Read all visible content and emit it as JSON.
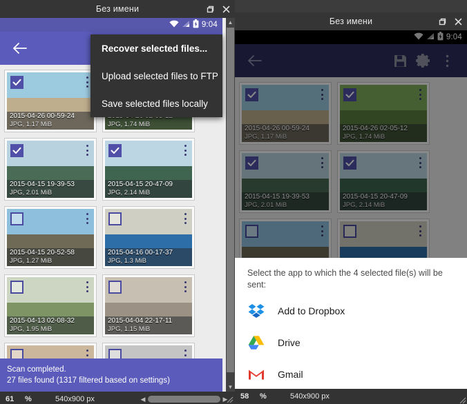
{
  "left_window": {
    "title": "Без имени",
    "statusbar": {
      "time": "9:04",
      "wifi": "wifi-icon",
      "signal": "signal-icon",
      "battery": "battery-charging-icon"
    },
    "toolbar": {
      "back": "back-arrow-icon"
    },
    "overflow_menu": {
      "items": [
        {
          "label": "Recover selected files...",
          "bold": true
        },
        {
          "label": "Upload selected files to FTP",
          "bold": false
        },
        {
          "label": "Save selected files locally",
          "bold": false
        }
      ]
    },
    "files": [
      {
        "name": "2015-04-26 00-59-24",
        "size": "JPG, 1.17 MiB",
        "checked": true,
        "sky": "#9ccadf",
        "ground": "#bfae8d"
      },
      {
        "name": "2015-04-26 02-05-12",
        "size": "JPG, 1.74 MiB",
        "checked": true,
        "sky": "#7fae5c",
        "ground": "#5b7e3e"
      },
      {
        "name": "2015-04-15 19-39-53",
        "size": "JPG, 2.01 MiB",
        "checked": true,
        "sky": "#b9d2e0",
        "ground": "#4a6b55"
      },
      {
        "name": "2015-04-15 20-47-09",
        "size": "JPG, 2.14 MiB",
        "checked": true,
        "sky": "#bcd6e4",
        "ground": "#3f6550"
      },
      {
        "name": "2015-04-15 20-52-58",
        "size": "JPG, 1.27 MiB",
        "checked": false,
        "sky": "#8ec0de",
        "ground": "#6e6a56"
      },
      {
        "name": "2015-04-16 00-17-37",
        "size": "JPG, 1.3 MiB",
        "checked": false,
        "sky": "#cfcfc4",
        "ground": "#2e6ea8"
      },
      {
        "name": "2015-04-13 02-08-32",
        "size": "JPG, 1.95 MiB",
        "checked": false,
        "sky": "#cdd6c3",
        "ground": "#7e9464"
      },
      {
        "name": "2015-04-04 22-17-11",
        "size": "JPG, 1.15 MiB",
        "checked": false,
        "sky": "#c7bfb2",
        "ground": "#9b9184"
      },
      {
        "name": "",
        "size": "",
        "checked": false,
        "sky": "#cbb79c",
        "ground": "#b5a288"
      },
      {
        "name": "",
        "size": "",
        "checked": false,
        "sky": "#c4c4c4",
        "ground": "#b2b2b2"
      }
    ],
    "snackbar": {
      "line1": "Scan completed.",
      "line2": "27 files found (1317 filtered based on settings)"
    },
    "footer": {
      "zoom": "61",
      "percent": "%",
      "resolution": "540x900 px"
    }
  },
  "right_window": {
    "title": "Без имени",
    "statusbar": {
      "time": "9:04",
      "wifi": "wifi-icon",
      "signal": "signal-icon",
      "battery": "battery-charging-icon"
    },
    "toolbar": {
      "back": "back-arrow-icon",
      "save": "save-disk-icon",
      "settings": "gear-icon",
      "overflow": "overflow-menu-icon"
    },
    "files": [
      {
        "name": "2015-04-26 00-59-24",
        "size": "JPG, 1.17 MiB",
        "checked": true,
        "sky": "#9ccadf",
        "ground": "#bfae8d"
      },
      {
        "name": "2015-04-26 02-05-12",
        "size": "JPG, 1.74 MiB",
        "checked": true,
        "sky": "#7fae5c",
        "ground": "#5b7e3e"
      },
      {
        "name": "2015-04-15 19-39-53",
        "size": "JPG, 2.01 MiB",
        "checked": true,
        "sky": "#b9d2e0",
        "ground": "#4a6b55"
      },
      {
        "name": "2015-04-15 20-47-09",
        "size": "JPG, 2.14 MiB",
        "checked": true,
        "sky": "#bcd6e4",
        "ground": "#3f6550"
      },
      {
        "name": "2015-04-15 20-52-58",
        "size": "",
        "checked": false,
        "sky": "#8ec0de",
        "ground": "#6e6a56"
      },
      {
        "name": "2015-04-16 00-17-37",
        "size": "",
        "checked": false,
        "sky": "#cfcfc4",
        "ground": "#2e6ea8"
      }
    ],
    "dialog": {
      "title": "Select the app to which the 4 selected file(s) will be sent:",
      "apps": [
        {
          "label": "Add to Dropbox",
          "icon": "dropbox-icon"
        },
        {
          "label": "Drive",
          "icon": "google-drive-icon"
        },
        {
          "label": "Gmail",
          "icon": "gmail-icon"
        }
      ]
    },
    "footer": {
      "zoom": "58",
      "percent": "%",
      "resolution": "540x900 px"
    }
  },
  "colors": {
    "accent_purple": "#5b5bbb",
    "toolbar_purple_left": "#5757ab",
    "toolbar_purple_right": "#2c2c5c",
    "menu_bg": "#333333",
    "window_chrome": "#353535",
    "grid_bg": "#ececec"
  }
}
